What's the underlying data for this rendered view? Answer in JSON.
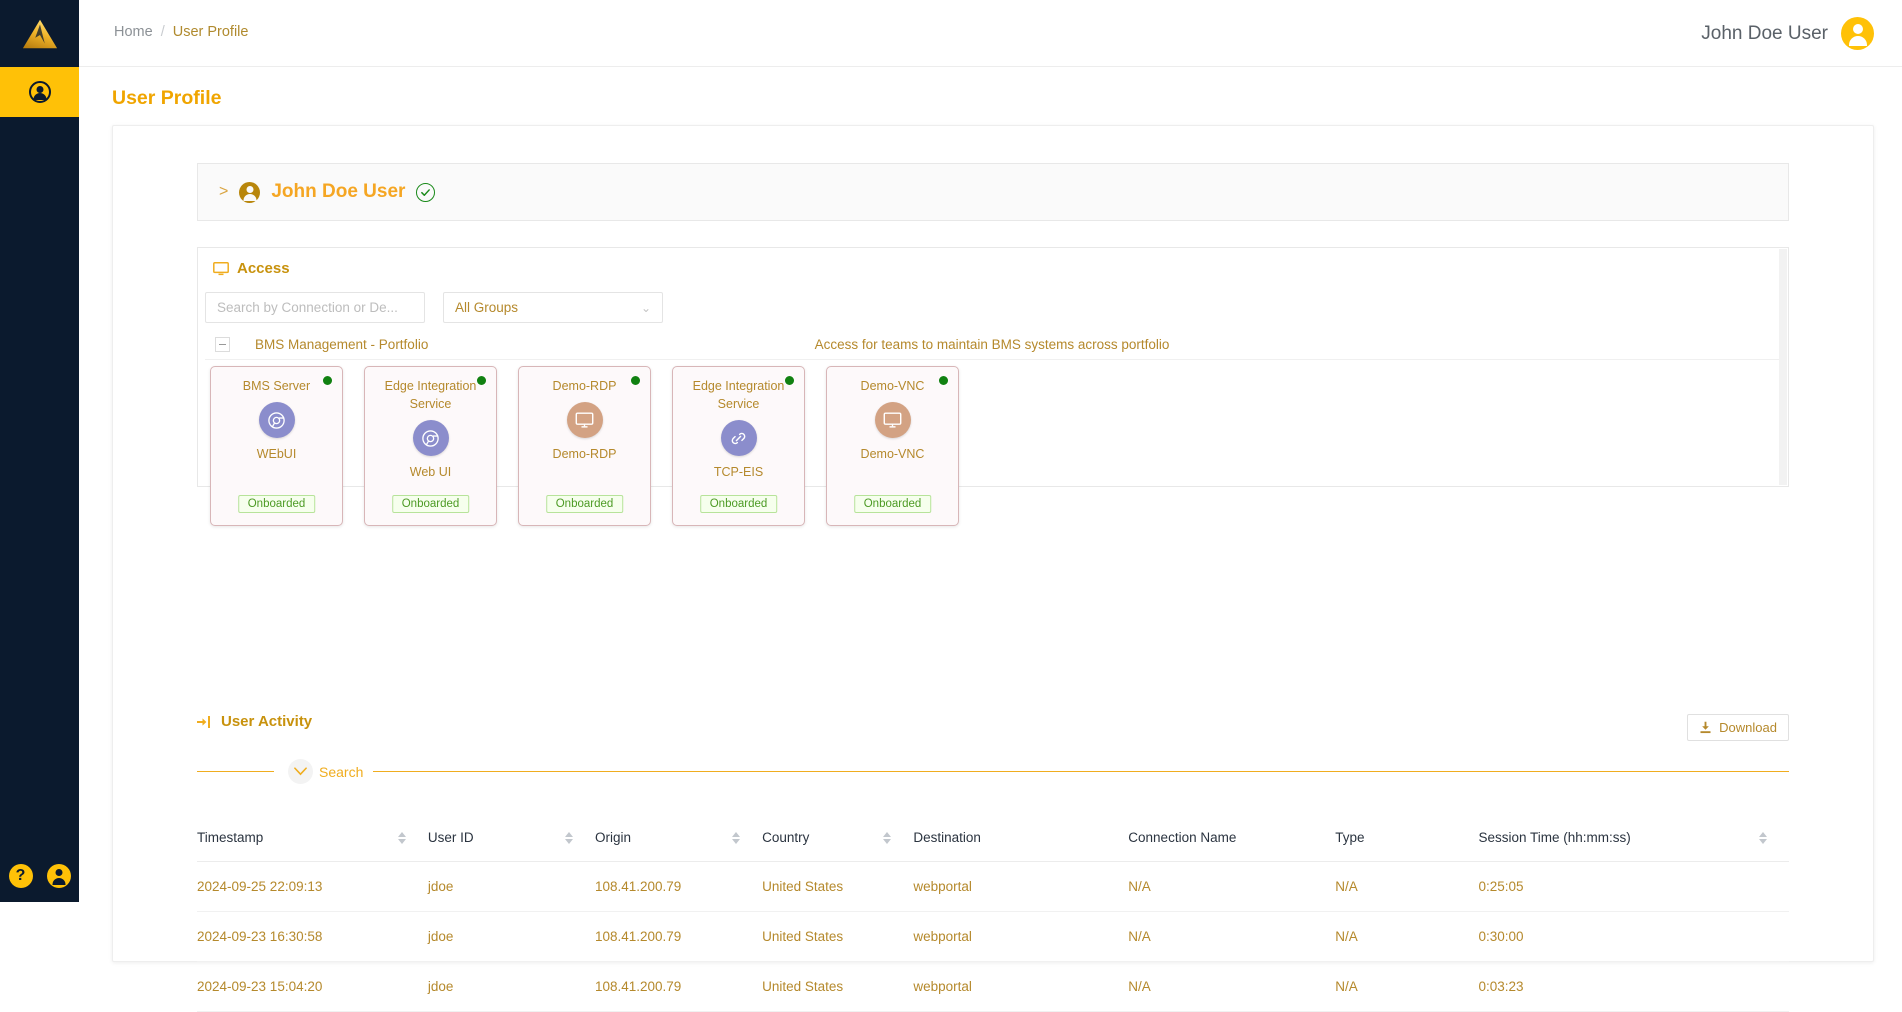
{
  "sidebar": {
    "logo_icon": "mountain-logo",
    "items": [
      {
        "icon": "user-circle-icon",
        "active": true,
        "label": "User Profile"
      }
    ],
    "bottom_items": [
      {
        "icon": "help-circle-icon",
        "label": "?"
      },
      {
        "icon": "user-circle-icon",
        "label": ""
      }
    ]
  },
  "topbar": {
    "breadcrumb": {
      "home": "Home",
      "separator": "/",
      "current": "User Profile"
    },
    "user": {
      "name": "John Doe User",
      "avatar_icon": "user-avatar-icon"
    }
  },
  "page": {
    "title": "User Profile"
  },
  "user_panel": {
    "expand_icon": ">",
    "user_icon": "user-circle-icon",
    "name": "John Doe User",
    "verified_icon": "check-circle-icon"
  },
  "access": {
    "icon": "monitor-icon",
    "title": "Access",
    "search": {
      "value": "",
      "placeholder": "Search by Connection or De..."
    },
    "group_select": {
      "value": "All Groups",
      "chevron": "chevron-down-icon"
    },
    "group": {
      "toggle": "collapse-minus",
      "name": "BMS Management - Portfolio",
      "description": "Access for teams to maintain BMS systems across portfolio"
    },
    "cards": [
      {
        "title": "BMS Server",
        "icon": "browser-icon",
        "icon_type": "browser",
        "subtitle": "WEbUI",
        "status": "online",
        "badge": "Onboarded"
      },
      {
        "title": "Edge Integration Service",
        "icon": "browser-icon",
        "icon_type": "browser",
        "subtitle": "Web UI",
        "status": "online",
        "badge": "Onboarded"
      },
      {
        "title": "Demo-RDP",
        "icon": "monitor-icon",
        "icon_type": "screen",
        "subtitle": "Demo-RDP",
        "status": "online",
        "badge": "Onboarded"
      },
      {
        "title": "Edge Integration Service",
        "icon": "link-icon",
        "icon_type": "link",
        "subtitle": "TCP-EIS",
        "status": "online",
        "badge": "Onboarded"
      },
      {
        "title": "Demo-VNC",
        "icon": "monitor-icon",
        "icon_type": "screen",
        "subtitle": "Demo-VNC",
        "status": "online",
        "badge": "Onboarded"
      }
    ]
  },
  "activity": {
    "icon": "login-arrow-icon",
    "title": "User Activity",
    "download": {
      "icon": "download-icon",
      "label": "Download"
    },
    "search_toggle": {
      "icon": "chevron-down-icon",
      "label": "Search"
    },
    "columns": [
      {
        "label": "Timestamp",
        "sortable": true
      },
      {
        "label": "User ID",
        "sortable": true
      },
      {
        "label": "Origin",
        "sortable": true
      },
      {
        "label": "Country",
        "sortable": true
      },
      {
        "label": "Destination",
        "sortable": false
      },
      {
        "label": "Connection Name",
        "sortable": false
      },
      {
        "label": "Type",
        "sortable": false
      },
      {
        "label": "Session Time (hh:mm:ss)",
        "sortable": true
      }
    ],
    "rows": [
      {
        "timestamp": "2024-09-25 22:09:13",
        "user_id": "jdoe",
        "origin": "108.41.200.79",
        "country": "United States",
        "destination": "webportal",
        "connection_name": "N/A",
        "type": "N/A",
        "session_time": "0:25:05"
      },
      {
        "timestamp": "2024-09-23 16:30:58",
        "user_id": "jdoe",
        "origin": "108.41.200.79",
        "country": "United States",
        "destination": "webportal",
        "connection_name": "N/A",
        "type": "N/A",
        "session_time": "0:30:00"
      },
      {
        "timestamp": "2024-09-23 15:04:20",
        "user_id": "jdoe",
        "origin": "108.41.200.79",
        "country": "United States",
        "destination": "webportal",
        "connection_name": "N/A",
        "type": "N/A",
        "session_time": "0:03:23"
      }
    ]
  },
  "colors": {
    "brand_yellow": "#ffc107",
    "title_orange": "#f0a500",
    "sidebar_navy": "#0b1a2e",
    "data_brown": "#b5892c",
    "status_green": "#118111",
    "card_border": "#d8b6b8",
    "browser_purple": "#8b8dcc",
    "screen_tan": "#d3a283"
  }
}
